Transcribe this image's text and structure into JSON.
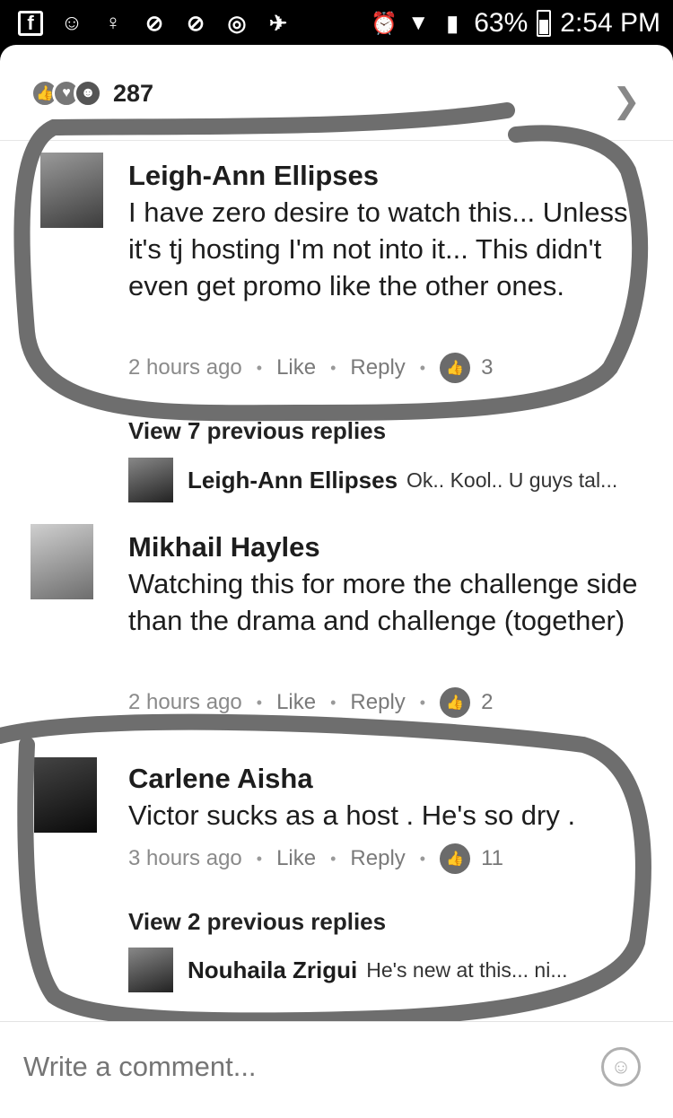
{
  "status_bar": {
    "battery": "63%",
    "time": "2:54 PM"
  },
  "reactions": {
    "count": "287"
  },
  "comments": [
    {
      "author": "Leigh-Ann Ellipses",
      "text": "I have zero desire to watch this... Unless it's tj hosting I'm not into it... This didn't even get promo like the other ones.",
      "time": "2 hours ago",
      "like": "Like",
      "reply": "Reply",
      "likes": "3",
      "view_prev": "View 7 previous replies",
      "reply_preview": {
        "author": "Leigh-Ann Ellipses",
        "text": "Ok.. Kool.. U guys tal..."
      }
    },
    {
      "author": "Mikhail Hayles",
      "text": "Watching this for more the challenge side than the drama and challenge (together)",
      "time": "2 hours ago",
      "like": "Like",
      "reply": "Reply",
      "likes": "2"
    },
    {
      "author": "Carlene Aisha",
      "text": "Victor sucks as a host . He's so dry .",
      "time": "3 hours ago",
      "like": "Like",
      "reply": "Reply",
      "likes": "11",
      "view_prev": "View 2 previous replies",
      "reply_preview": {
        "author": "Nouhaila Zrigui",
        "text": "He's new at this... ni..."
      }
    }
  ],
  "composer": {
    "placeholder": "Write a comment..."
  },
  "colors": {
    "annotation_stroke": "#6e6e6e"
  }
}
